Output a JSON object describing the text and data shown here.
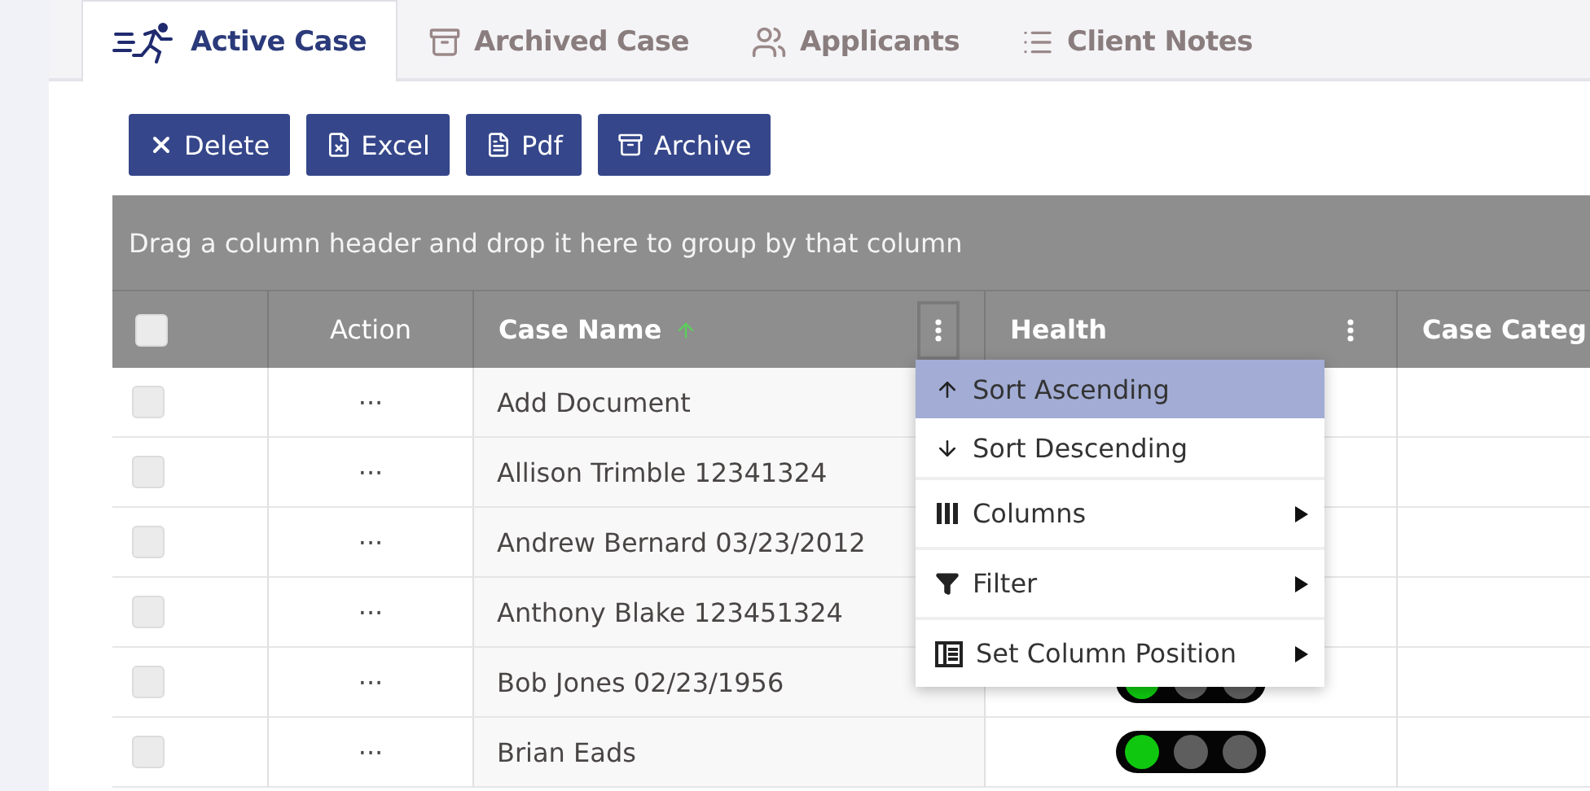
{
  "tabs": [
    {
      "label": "Active Case",
      "selected": true,
      "kind": "runner"
    },
    {
      "label": "Archived Case",
      "selected": false,
      "kind": "archive"
    },
    {
      "label": "Applicants",
      "selected": false,
      "kind": "people"
    },
    {
      "label": "Client Notes",
      "selected": false,
      "kind": "list"
    }
  ],
  "toolbar": [
    {
      "label": "Delete",
      "kind": "delete"
    },
    {
      "label": "Excel",
      "kind": "excel"
    },
    {
      "label": "Pdf",
      "kind": "pdf"
    },
    {
      "label": "Archive",
      "kind": "archive"
    }
  ],
  "grid": {
    "group_panel": "Drag a column header and drop it here to group by that column",
    "header_checkbox": {
      "checked": false
    },
    "columns": [
      {
        "label": "Action",
        "bold": false,
        "sorted": false,
        "menu_button": false
      },
      {
        "label": "Case Name",
        "bold": true,
        "sorted": true,
        "menu_button": true,
        "menu_open": true
      },
      {
        "label": "Health",
        "bold": true,
        "sorted": false,
        "menu_button": true,
        "menu_open": false
      },
      {
        "label": "Case Categ",
        "bold": true,
        "sorted": false,
        "menu_button": false
      }
    ],
    "rows": [
      {
        "checked": false,
        "action": "···",
        "case_name": "Add Document"
      },
      {
        "checked": false,
        "action": "···",
        "case_name": "Allison Trimble 12341324"
      },
      {
        "checked": false,
        "action": "···",
        "case_name": "Andrew Bernard 03/23/2012"
      },
      {
        "checked": false,
        "action": "···",
        "case_name": "Anthony Blake 123451324"
      },
      {
        "checked": false,
        "action": "···",
        "case_name": "Bob Jones 02/23/1956",
        "health": [
          {
            "on": true
          },
          {
            "on": false
          },
          {
            "on": false
          }
        ]
      },
      {
        "checked": false,
        "action": "···",
        "case_name": "Brian Eads",
        "health": [
          {
            "on": true
          },
          {
            "on": false
          },
          {
            "on": false
          }
        ]
      }
    ],
    "column_menu": [
      {
        "label": "Sort Ascending",
        "kind": "sort-up",
        "selected": true,
        "submenu": false
      },
      {
        "label": "Sort Descending",
        "kind": "sort-down",
        "selected": false,
        "submenu": false
      },
      {
        "label": "Columns",
        "kind": "columns",
        "selected": false,
        "submenu": true
      },
      {
        "label": "Filter",
        "kind": "filter",
        "selected": false,
        "submenu": true
      },
      {
        "label": "Set Column Position",
        "kind": "position",
        "selected": false,
        "submenu": true
      }
    ]
  }
}
